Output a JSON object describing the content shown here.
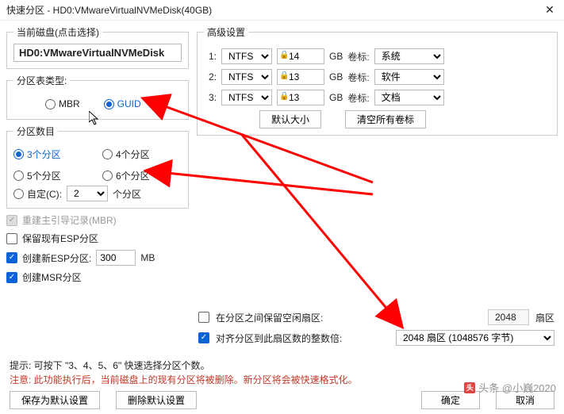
{
  "title": "快速分区 - HD0:VMwareVirtualNVMeDisk(40GB)",
  "currentDisk": {
    "legend": "当前磁盘(点击选择)",
    "value": "HD0:VMwareVirtualNVMeDisk"
  },
  "tableType": {
    "legend": "分区表类型:",
    "mbr": "MBR",
    "guid": "GUID",
    "selected": "guid"
  },
  "partitionCount": {
    "legend": "分区数目",
    "opts": {
      "p3": "3个分区",
      "p4": "4个分区",
      "p5": "5个分区",
      "p6": "6个分区",
      "custom": "自定(C):"
    },
    "selected": "p3",
    "customValue": "2",
    "customUnit": "个分区"
  },
  "checks": {
    "rebuildMbr": "重建主引导记录(MBR)",
    "keepEsp": "保留现有ESP分区",
    "createEsp": "创建新ESP分区:",
    "espSize": "300",
    "espUnit": "MB",
    "createMsr": "创建MSR分区"
  },
  "advanced": {
    "legend": "高级设置",
    "rows": [
      {
        "idx": "1:",
        "fs": "NTFS",
        "size": "14",
        "unit": "GB",
        "volLabel": "卷标:",
        "vol": "系统"
      },
      {
        "idx": "2:",
        "fs": "NTFS",
        "size": "13",
        "unit": "GB",
        "volLabel": "卷标:",
        "vol": "软件"
      },
      {
        "idx": "3:",
        "fs": "NTFS",
        "size": "13",
        "unit": "GB",
        "volLabel": "卷标:",
        "vol": "文档"
      }
    ],
    "defaultSize": "默认大小",
    "clearLabels": "清空所有卷标"
  },
  "gap": {
    "keepGap": "在分区之间保留空闲扇区:",
    "gapVal": "2048",
    "gapUnit": "扇区",
    "align": "对齐分区到此扇区数的整数倍:",
    "alignVal": "2048 扇区 (1048576 字节)"
  },
  "notes": {
    "tip": "提示: 可按下 \"3、4、5、6\" 快速选择分区个数。",
    "warn": "注意: 此功能执行后，当前磁盘上的现有分区将被删除。新分区将会被快速格式化。"
  },
  "footer": {
    "saveDefault": "保存为默认设置",
    "deleteDefault": "删除默认设置",
    "ok": "确定",
    "cancel": "取消"
  },
  "watermark": "头条 @小巍2020"
}
